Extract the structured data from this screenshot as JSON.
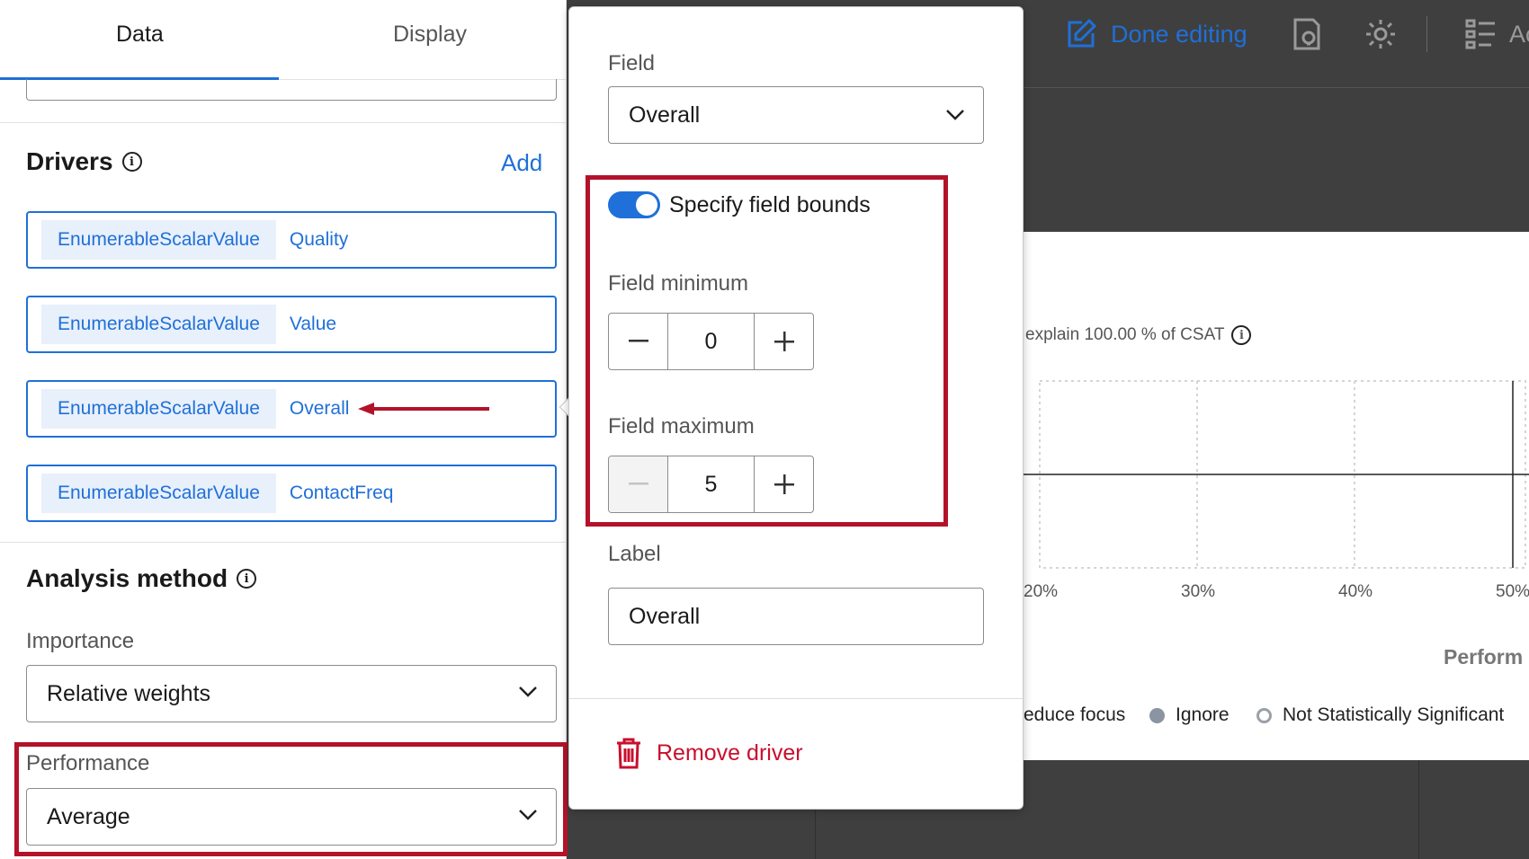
{
  "toolbar": {
    "done_editing_label": "Done editing",
    "add_label_partial": "Ac",
    "accent_color": "#1f70d8"
  },
  "left_panel": {
    "tabs": [
      {
        "label": "Data",
        "active": true
      },
      {
        "label": "Display",
        "active": false
      }
    ],
    "drivers": {
      "title": "Drivers",
      "add_label": "Add",
      "items": [
        {
          "type": "EnumerableScalarValue",
          "field": "Quality"
        },
        {
          "type": "EnumerableScalarValue",
          "field": "Value"
        },
        {
          "type": "EnumerableScalarValue",
          "field": "Overall"
        },
        {
          "type": "EnumerableScalarValue",
          "field": "ContactFreq"
        }
      ]
    },
    "analysis_method": {
      "title": "Analysis method",
      "importance_label": "Importance",
      "importance_value": "Relative weights",
      "performance_label": "Performance",
      "performance_value": "Average"
    }
  },
  "popover": {
    "field_label": "Field",
    "field_value": "Overall",
    "specify_bounds_label": "Specify field bounds",
    "specify_bounds_enabled": true,
    "min_label": "Field minimum",
    "min_value": "0",
    "max_label": "Field maximum",
    "max_value": "5",
    "label_label": "Label",
    "label_value": "Overall",
    "remove_label": "Remove driver",
    "danger_color": "#c8102e"
  },
  "background_widget": {
    "summary_text": "explain 100.00 % of CSAT",
    "x_ticks": [
      "20%",
      "30%",
      "40%",
      "50%"
    ],
    "x_axis_title_partial": "Perform",
    "legend": [
      {
        "label": "educe focus",
        "marker": "none"
      },
      {
        "label": "Ignore",
        "marker": "filled-dot",
        "color": "#8a94a3"
      },
      {
        "label": "Not Statistically Significant",
        "marker": "hollow-dot",
        "color": "#9aa0a8"
      }
    ]
  },
  "annotation_color": "#b3132a"
}
